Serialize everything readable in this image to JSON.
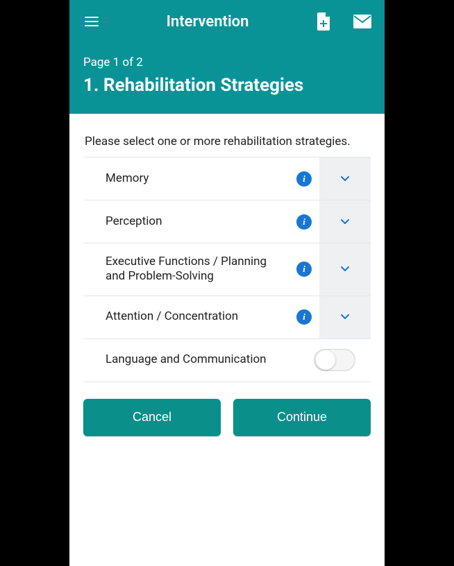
{
  "colors": {
    "primary": "#0a9396",
    "info": "#1976d2"
  },
  "topbar": {
    "title": "Intervention"
  },
  "subheader": {
    "page_indicator": "Page 1 of 2",
    "title": "1. Rehabilitation Strategies"
  },
  "prompt": "Please select one or more rehabilitation strategies.",
  "rows": {
    "memory": {
      "label": "Memory"
    },
    "perception": {
      "label": "Perception"
    },
    "executive": {
      "label": "Executive Functions / Planning and Problem-Solving"
    },
    "attention": {
      "label": "Attention / Concentration"
    },
    "language": {
      "label": "Language and Communication",
      "toggle_on": false
    }
  },
  "buttons": {
    "cancel": "Cancel",
    "continue": "Continue"
  },
  "icons": {
    "info_glyph": "i"
  }
}
